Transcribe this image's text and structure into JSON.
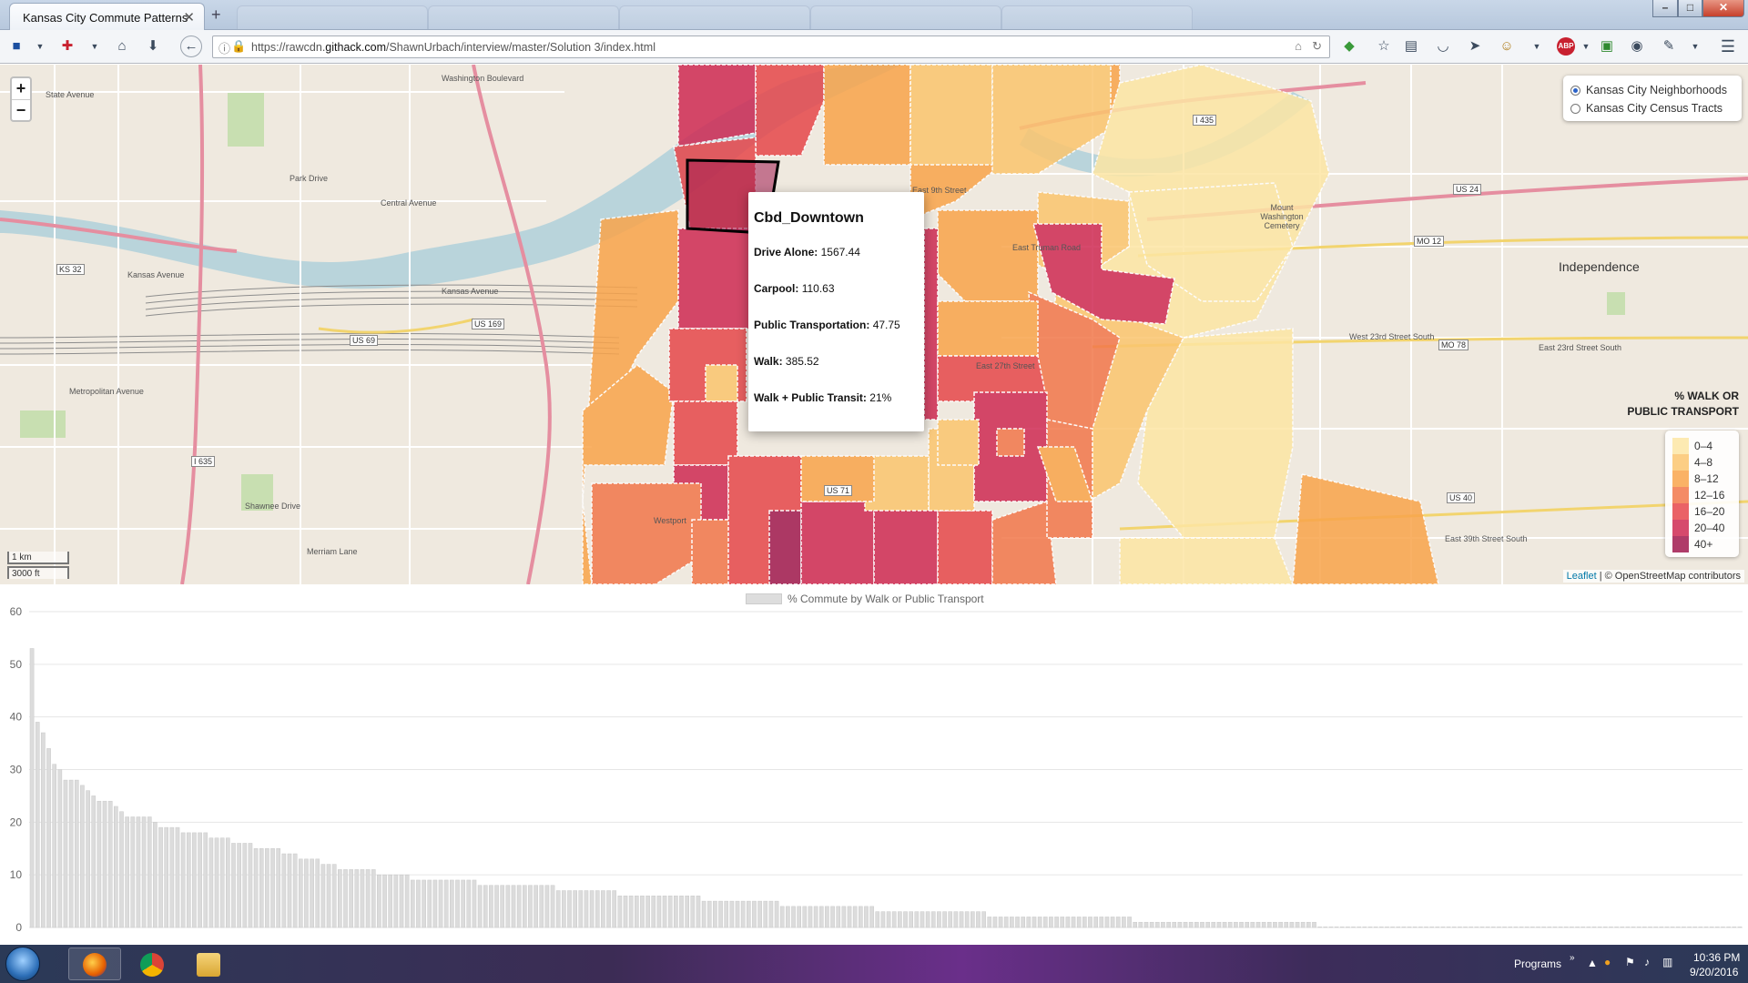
{
  "browser": {
    "tab_title": "Kansas City Commute Patterns",
    "url_prefix": "https://rawcdn.",
    "url_host": "githack.com",
    "url_path": "/ShawnUrbach/interview/master/Solution 3/index.html"
  },
  "map": {
    "layer_control": {
      "options": [
        {
          "label": "Kansas City Neighborhoods",
          "selected": true
        },
        {
          "label": "Kansas City Census Tracts",
          "selected": false
        }
      ]
    },
    "popup": {
      "title": "Cbd_Downtown",
      "rows": [
        {
          "label": "Drive Alone:",
          "value": "1567.44"
        },
        {
          "label": "Carpool:",
          "value": "110.63"
        },
        {
          "label": "Public Transportation:",
          "value": "47.75"
        },
        {
          "label": "Walk:",
          "value": "385.52"
        },
        {
          "label": "Walk + Public Transit:",
          "value": "21%"
        }
      ]
    },
    "legend": {
      "title_line1": "% WALK OR",
      "title_line2": "PUBLIC TRANSPORT",
      "items": [
        {
          "label": "0–4",
          "color": "#fde6a4"
        },
        {
          "label": "4–8",
          "color": "#fbc56e"
        },
        {
          "label": "8–12",
          "color": "#f9a44b"
        },
        {
          "label": "12–16",
          "color": "#f2774a"
        },
        {
          "label": "16–20",
          "color": "#e6474b"
        },
        {
          "label": "20–40",
          "color": "#cf2a53"
        },
        {
          "label": "40+",
          "color": "#a11a4f"
        }
      ]
    },
    "scale": {
      "metric": "1 km",
      "imperial": "3000 ft"
    },
    "attribution": {
      "leaflet": "Leaflet",
      "rest": "| © OpenStreetMap contributors"
    },
    "labels": {
      "state_avenue": "State Avenue",
      "washington_blvd": "Washington Boulevard",
      "park_drive": "Park Drive",
      "central_avenue": "Central Avenue",
      "kansas_avenue": "Kansas Avenue",
      "kansas_avenue2": "Kansas Avenue",
      "metropolitan_avenue": "Metropolitan Avenue",
      "east_9th": "East 9th Street",
      "east_truman": "East Truman Road",
      "east_27th": "East 27th Street",
      "westport": "Westport",
      "mount_washington": "Mount Washington Cemetery",
      "independence": "Independence",
      "west_23rd": "West 23rd Street South",
      "east_23rd": "East 23rd Street South",
      "east_39th": "East 39th Street South",
      "shawnee_drive": "Shawnee Drive",
      "merriam_lane": "Merriam Lane"
    },
    "routes": [
      "US 69",
      "US 169",
      "I 635",
      "KS 32",
      "US 24",
      "MO 12",
      "MO 78",
      "US 40",
      "I 435",
      "US 71"
    ]
  },
  "chart_data": {
    "type": "bar",
    "legend_label": "% Commute by Walk or Public Transport",
    "ylim": [
      0,
      60
    ],
    "yticks": [
      0,
      10,
      20,
      30,
      40,
      50,
      60
    ],
    "values": [
      53,
      39,
      37,
      34,
      31,
      30,
      28,
      28,
      28,
      27,
      26,
      25,
      24,
      24,
      24,
      23,
      22,
      21,
      21,
      21,
      21,
      21,
      20,
      19,
      19,
      19,
      19,
      18,
      18,
      18,
      18,
      18,
      17,
      17,
      17,
      17,
      16,
      16,
      16,
      16,
      15,
      15,
      15,
      15,
      15,
      14,
      14,
      14,
      13,
      13,
      13,
      13,
      12,
      12,
      12,
      11,
      11,
      11,
      11,
      11,
      11,
      11,
      10,
      10,
      10,
      10,
      10,
      10,
      9,
      9,
      9,
      9,
      9,
      9,
      9,
      9,
      9,
      9,
      9,
      9,
      8,
      8,
      8,
      8,
      8,
      8,
      8,
      8,
      8,
      8,
      8,
      8,
      8,
      8,
      7,
      7,
      7,
      7,
      7,
      7,
      7,
      7,
      7,
      7,
      7,
      6,
      6,
      6,
      6,
      6,
      6,
      6,
      6,
      6,
      6,
      6,
      6,
      6,
      6,
      6,
      5,
      5,
      5,
      5,
      5,
      5,
      5,
      5,
      5,
      5,
      5,
      5,
      5,
      5,
      4,
      4,
      4,
      4,
      4,
      4,
      4,
      4,
      4,
      4,
      4,
      4,
      4,
      4,
      4,
      4,
      4,
      3,
      3,
      3,
      3,
      3,
      3,
      3,
      3,
      3,
      3,
      3,
      3,
      3,
      3,
      3,
      3,
      3,
      3,
      3,
      3,
      2,
      2,
      2,
      2,
      2,
      2,
      2,
      2,
      2,
      2,
      2,
      2,
      2,
      2,
      2,
      2,
      2,
      2,
      2,
      2,
      2,
      2,
      2,
      2,
      2,
      2,
      1,
      1,
      1,
      1,
      1,
      1,
      1,
      1,
      1,
      1,
      1,
      1,
      1,
      1,
      1,
      1,
      1,
      1,
      1,
      1,
      1,
      1,
      1,
      1,
      1,
      1,
      1,
      1,
      1,
      1,
      1,
      1,
      1,
      0,
      0,
      0,
      0,
      0,
      0,
      0,
      0,
      0,
      0,
      0,
      0,
      0,
      0,
      0,
      0,
      0,
      0,
      0,
      0,
      0,
      0,
      0,
      0,
      0,
      0,
      0,
      0,
      0,
      0,
      0,
      0,
      0,
      0,
      0,
      0,
      0,
      0,
      0,
      0,
      0,
      0,
      0,
      0,
      0,
      0,
      0,
      0,
      0,
      0,
      0,
      0,
      0,
      0,
      0,
      0,
      0,
      0,
      0,
      0,
      0,
      0,
      0,
      0,
      0,
      0,
      0,
      0,
      0,
      0,
      0,
      0,
      0,
      0,
      0,
      0
    ]
  },
  "taskbar": {
    "programs_label": "Programs",
    "time": "10:36 PM",
    "date": "9/20/2016"
  }
}
